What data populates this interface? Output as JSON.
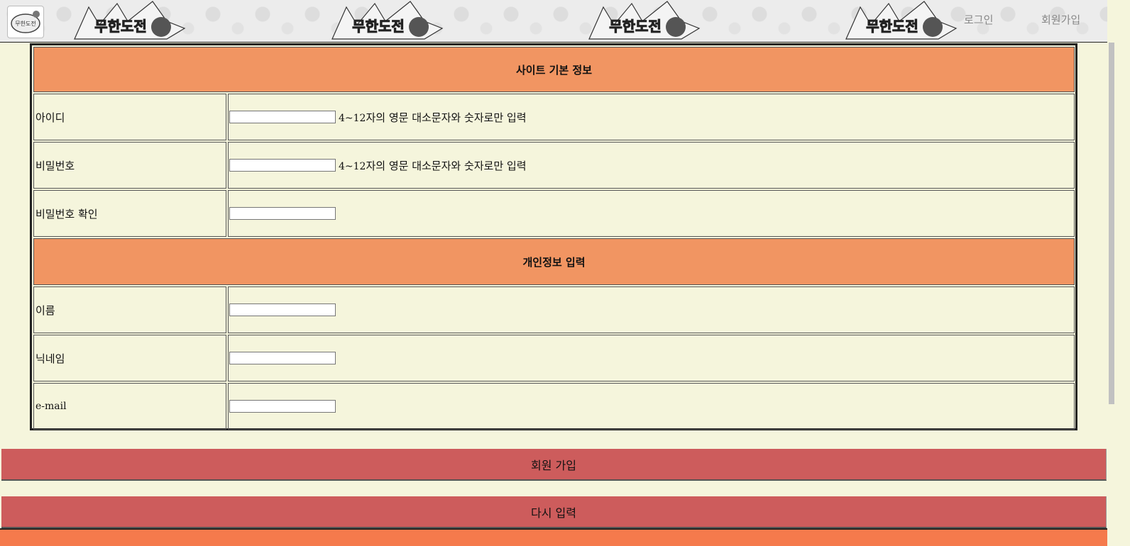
{
  "header": {
    "logo_text": "무한도전",
    "banner_text": "무한도전",
    "nav": {
      "login": "로그인",
      "signup": "회원가입"
    }
  },
  "form": {
    "section_site": "사이트 기본 정보",
    "section_personal": "개인정보 입력",
    "fields": {
      "id": {
        "label": "아이디",
        "value": "",
        "hint_num": "4~12",
        "hint_text": "자의 영문 대소문자와 숫자로만 입력"
      },
      "password": {
        "label": "비밀번호",
        "value": "",
        "hint_num": "4~12",
        "hint_text": "자의 영문 대소문자와 숫자로만 입력"
      },
      "password_confirm": {
        "label": "비밀번호 확인",
        "value": ""
      },
      "name": {
        "label": "이름",
        "value": ""
      },
      "nickname": {
        "label": "닉네임",
        "value": ""
      },
      "email": {
        "label": "e-mail",
        "value": ""
      }
    }
  },
  "buttons": {
    "submit": "회원 가입",
    "reset": "다시 입력"
  },
  "colors": {
    "page_bg": "#f5f5dc",
    "section_bg": "#f19562",
    "button_bg": "#cd5c5c",
    "footer_bg": "#f57a4c"
  }
}
